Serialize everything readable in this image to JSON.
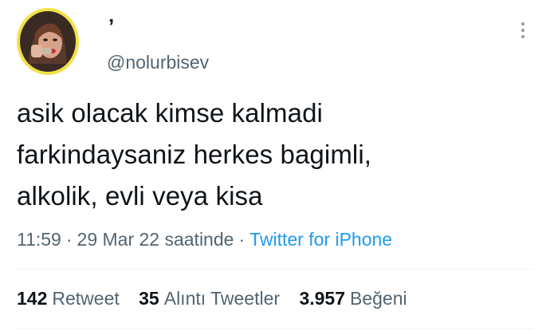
{
  "tweet": {
    "display_name": "’",
    "handle": "@nolurbisev",
    "text": "asik olacak kimse kalmadi\nfarkindaysaniz herkes bagimli,\nalkolik, evli veya kisa",
    "time": "11:59",
    "date": "29 Mar 22 saatinde",
    "separator": "·",
    "source": "Twitter for iPhone"
  },
  "stats": [
    {
      "count": "142",
      "label": "Retweet"
    },
    {
      "count": "35",
      "label": "Alıntı Tweetler"
    },
    {
      "count": "3.957",
      "label": "Beğeni"
    }
  ],
  "colors": {
    "text": "#0f1419",
    "secondary": "#536471",
    "link": "#1d9bf0",
    "avatar_ring": "#f2e04a"
  },
  "icons": {
    "more": "more-vertical-icon"
  }
}
